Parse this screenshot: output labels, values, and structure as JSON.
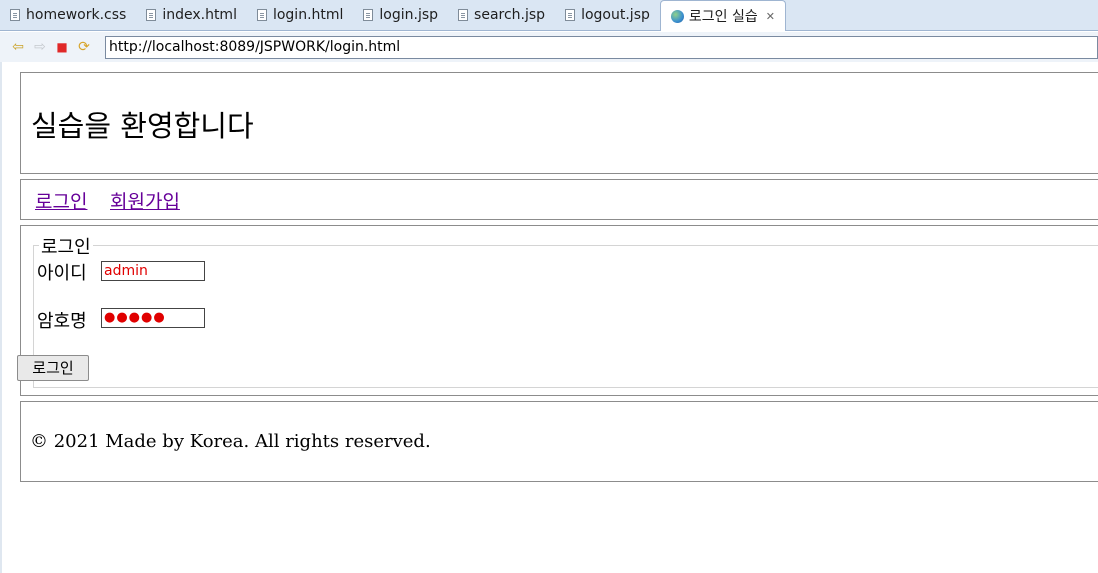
{
  "tabs": [
    {
      "label": "homework.css",
      "icon": "file-icon"
    },
    {
      "label": "index.html",
      "icon": "file-icon"
    },
    {
      "label": "login.html",
      "icon": "file-icon"
    },
    {
      "label": "login.jsp",
      "icon": "file-icon"
    },
    {
      "label": "search.jsp",
      "icon": "file-icon"
    },
    {
      "label": "logout.jsp",
      "icon": "file-icon"
    },
    {
      "label": "로그인 실습",
      "icon": "globe-icon",
      "active": true
    }
  ],
  "browser": {
    "url": "http://localhost:8089/JSPWORK/login.html"
  },
  "page": {
    "heading": "실습을 환영합니다",
    "nav": [
      {
        "label": "로그인"
      },
      {
        "label": "회원가입"
      }
    ],
    "login": {
      "legend": "로그인",
      "id_label": "아이디",
      "id_value": "admin",
      "password_label": "암호명",
      "password_value": "●●●●●",
      "submit_label": "로그인"
    },
    "footer": "© 2021 Made by Korea. All rights reserved."
  },
  "colors": {
    "visited_link": "#660099",
    "input_text": "#e00000",
    "tabbar_bg": "#dae6f3"
  }
}
